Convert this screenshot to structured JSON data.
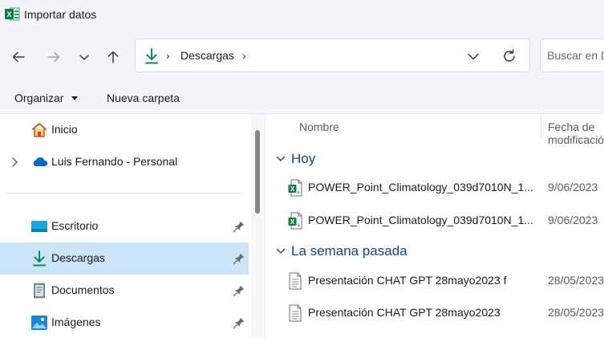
{
  "window": {
    "title": "Importar datos"
  },
  "address": {
    "path": "Descargas"
  },
  "search": {
    "placeholder": "Buscar en Descargas"
  },
  "commandbar": {
    "organize_label": "Organizar",
    "new_folder_label": "Nueva carpeta"
  },
  "sidebar": {
    "items": [
      {
        "label": "Inicio",
        "icon": "home-icon"
      },
      {
        "label": "Luis Fernando - Personal",
        "icon": "onedrive-cloud-icon"
      },
      {
        "label": "Escritorio",
        "icon": "desktop-icon",
        "pinned": true
      },
      {
        "label": "Descargas",
        "icon": "download-icon",
        "pinned": true,
        "selected": true
      },
      {
        "label": "Documentos",
        "icon": "document-icon",
        "pinned": true
      },
      {
        "label": "Imágenes",
        "icon": "pictures-icon",
        "pinned": true
      }
    ]
  },
  "columns": {
    "name": "Nombre",
    "date": "Fecha de modificación"
  },
  "groups": [
    {
      "label": "Hoy",
      "files": [
        {
          "name": "POWER_Point_Climatology_039d7010N_1...",
          "date": "9/06/2023",
          "icon": "excel-file-icon"
        },
        {
          "name": "POWER_Point_Climatology_039d7010N_1...",
          "date": "9/06/2023",
          "icon": "excel-file-icon"
        }
      ]
    },
    {
      "label": "La semana pasada",
      "files": [
        {
          "name": "Presentación CHAT GPT 28mayo2023 f",
          "date": "28/05/2023",
          "icon": "text-file-icon"
        },
        {
          "name": "Presentación CHAT GPT 28mayo2023",
          "date": "28/05/2023",
          "icon": "text-file-icon"
        }
      ]
    }
  ],
  "colors": {
    "accent": "#0f7b4f",
    "selection": "#cce4f7",
    "group_header": "#1f3c88",
    "excel": "#107c41"
  }
}
